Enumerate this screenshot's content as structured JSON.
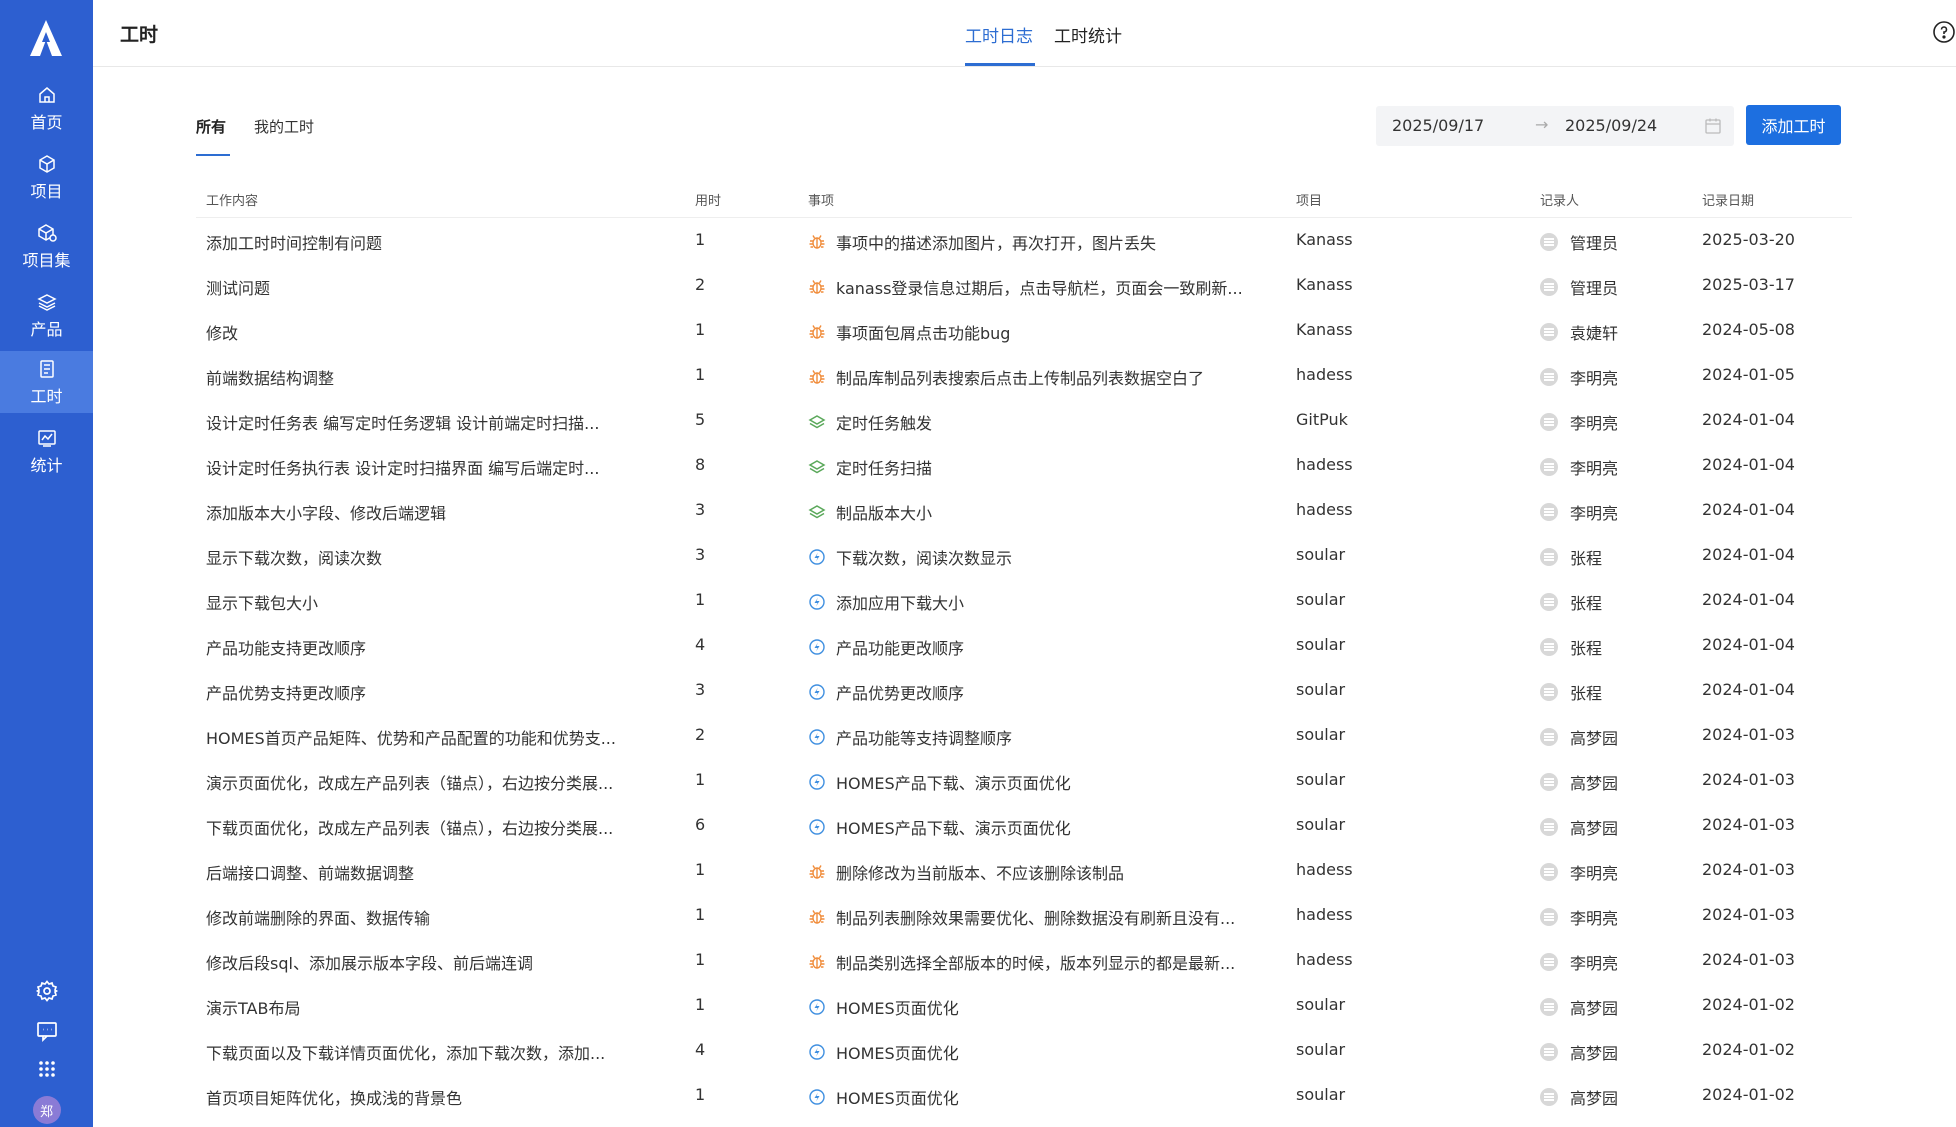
{
  "sidebar": {
    "logo": "tiklab-logo-icon",
    "items": [
      {
        "label": "首页",
        "icon": "home-icon"
      },
      {
        "label": "项目",
        "icon": "cube-icon"
      },
      {
        "label": "项目集",
        "icon": "cube-set-icon"
      },
      {
        "label": "产品",
        "icon": "layers-icon"
      },
      {
        "label": "工时",
        "icon": "worklog-icon",
        "active": true
      },
      {
        "label": "统计",
        "icon": "chart-icon"
      }
    ],
    "bottom": {
      "settings": "gear-icon",
      "message": "message-icon",
      "apps": "apps-grid-icon",
      "avatar": "郑"
    }
  },
  "header": {
    "title": "工时",
    "tabs": [
      "工时日志",
      "工时统计"
    ],
    "active_tab": "工时日志",
    "help_icon": "help-circle-icon"
  },
  "filter": {
    "tabs": [
      "所有",
      "我的工时"
    ],
    "active_tab": "所有",
    "date_start": "2025/09/17",
    "date_end": "2025/09/24",
    "arrow": "→",
    "calendar_icon": "calendar-icon",
    "add_button": "添加工时"
  },
  "colors": {
    "sidebar": "#2d5fd0",
    "accent": "#1d6fe0",
    "bug": "#f08c3a",
    "requirement": "#5aa85a",
    "task": "#3f8fe0"
  },
  "table": {
    "headers": [
      "工作内容",
      "用时",
      "事项",
      "项目",
      "记录人",
      "记录日期"
    ],
    "rows": [
      {
        "content": "添加工时时间控制有问题",
        "hours": "1",
        "item_type": "bug",
        "item": "事项中的描述添加图片，再次打开，图片丢失",
        "project": "Kanass",
        "recorder": "管理员",
        "date": "2025-03-20"
      },
      {
        "content": "测试问题",
        "hours": "2",
        "item_type": "bug",
        "item": "kanass登录信息过期后，点击导航栏，页面会一致刷新...",
        "project": "Kanass",
        "recorder": "管理员",
        "date": "2025-03-17"
      },
      {
        "content": "修改",
        "hours": "1",
        "item_type": "bug",
        "item": "事项面包屑点击功能bug",
        "project": "Kanass",
        "recorder": "袁婕轩",
        "date": "2024-05-08"
      },
      {
        "content": "前端数据结构调整",
        "hours": "1",
        "item_type": "bug",
        "item": "制品库制品列表搜索后点击上传制品列表数据空白了",
        "project": "hadess",
        "recorder": "李明亮",
        "date": "2024-01-05"
      },
      {
        "content": "设计定时任务表 编写定时任务逻辑 设计前端定时扫描...",
        "hours": "5",
        "item_type": "requirement",
        "item": "定时任务触发",
        "project": "GitPuk",
        "recorder": "李明亮",
        "date": "2024-01-04"
      },
      {
        "content": "设计定时任务执行表 设计定时扫描界面 编写后端定时...",
        "hours": "8",
        "item_type": "requirement",
        "item": "定时任务扫描",
        "project": "hadess",
        "recorder": "李明亮",
        "date": "2024-01-04"
      },
      {
        "content": "添加版本大小字段、修改后端逻辑",
        "hours": "3",
        "item_type": "requirement",
        "item": "制品版本大小",
        "project": "hadess",
        "recorder": "李明亮",
        "date": "2024-01-04"
      },
      {
        "content": "显示下载次数，阅读次数",
        "hours": "3",
        "item_type": "task",
        "item": "下载次数，阅读次数显示",
        "project": "soular",
        "recorder": "张程",
        "date": "2024-01-04"
      },
      {
        "content": "显示下载包大小",
        "hours": "1",
        "item_type": "task",
        "item": "添加应用下载大小",
        "project": "soular",
        "recorder": "张程",
        "date": "2024-01-04"
      },
      {
        "content": "产品功能支持更改顺序",
        "hours": "4",
        "item_type": "task",
        "item": "产品功能更改顺序",
        "project": "soular",
        "recorder": "张程",
        "date": "2024-01-04"
      },
      {
        "content": "产品优势支持更改顺序",
        "hours": "3",
        "item_type": "task",
        "item": "产品优势更改顺序",
        "project": "soular",
        "recorder": "张程",
        "date": "2024-01-04"
      },
      {
        "content": "HOMES首页产品矩阵、优势和产品配置的功能和优势支...",
        "hours": "2",
        "item_type": "task",
        "item": "产品功能等支持调整顺序",
        "project": "soular",
        "recorder": "高梦园",
        "date": "2024-01-03"
      },
      {
        "content": "演示页面优化，改成左产品列表（锚点），右边按分类展...",
        "hours": "1",
        "item_type": "task",
        "item": "HOMES产品下载、演示页面优化",
        "project": "soular",
        "recorder": "高梦园",
        "date": "2024-01-03"
      },
      {
        "content": "下载页面优化，改成左产品列表（锚点），右边按分类展...",
        "hours": "6",
        "item_type": "task",
        "item": "HOMES产品下载、演示页面优化",
        "project": "soular",
        "recorder": "高梦园",
        "date": "2024-01-03"
      },
      {
        "content": "后端接口调整、前端数据调整",
        "hours": "1",
        "item_type": "bug",
        "item": "删除修改为当前版本、不应该删除该制品",
        "project": "hadess",
        "recorder": "李明亮",
        "date": "2024-01-03"
      },
      {
        "content": "修改前端删除的界面、数据传输",
        "hours": "1",
        "item_type": "bug",
        "item": "制品列表删除效果需要优化、删除数据没有刷新且没有...",
        "project": "hadess",
        "recorder": "李明亮",
        "date": "2024-01-03"
      },
      {
        "content": "修改后段sql、添加展示版本字段、前后端连调",
        "hours": "1",
        "item_type": "bug",
        "item": "制品类别选择全部版本的时候，版本列显示的都是最新...",
        "project": "hadess",
        "recorder": "李明亮",
        "date": "2024-01-03"
      },
      {
        "content": "演示TAB布局",
        "hours": "1",
        "item_type": "task",
        "item": "HOMES页面优化",
        "project": "soular",
        "recorder": "高梦园",
        "date": "2024-01-02"
      },
      {
        "content": "下载页面以及下载详情页面优化，添加下载次数，添加...",
        "hours": "4",
        "item_type": "task",
        "item": "HOMES页面优化",
        "project": "soular",
        "recorder": "高梦园",
        "date": "2024-01-02"
      },
      {
        "content": "首页项目矩阵优化，换成浅的背景色",
        "hours": "1",
        "item_type": "task",
        "item": "HOMES页面优化",
        "project": "soular",
        "recorder": "高梦园",
        "date": "2024-01-02"
      }
    ]
  }
}
